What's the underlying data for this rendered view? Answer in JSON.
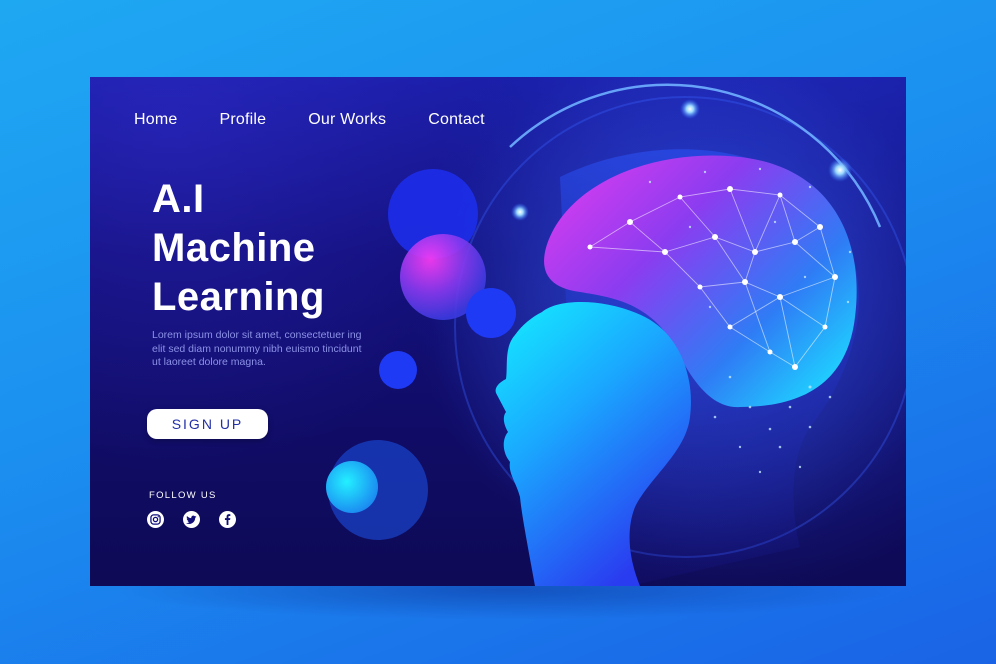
{
  "nav": {
    "items": [
      {
        "label": "Home"
      },
      {
        "label": "Profile"
      },
      {
        "label": "Our Works"
      },
      {
        "label": "Contact"
      }
    ]
  },
  "hero": {
    "title_lines": [
      "A.I",
      "Machine",
      "Learning"
    ],
    "description": "Lorem ipsum dolor sit amet, consectetuer ing elit sed diam nonummy nibh euismo tincidunt ut laoreet dolore magna.",
    "signup_label": "SIGN UP"
  },
  "social": {
    "label": "FOLLOW US",
    "icons": [
      "instagram-icon",
      "twitter-icon",
      "facebook-icon"
    ]
  },
  "colors": {
    "background": "#1b8ff0",
    "page_background": "#120f7a",
    "accent_cyan": "#19e0ff",
    "accent_magenta": "#e03cf0",
    "button_text": "#2230a6"
  }
}
